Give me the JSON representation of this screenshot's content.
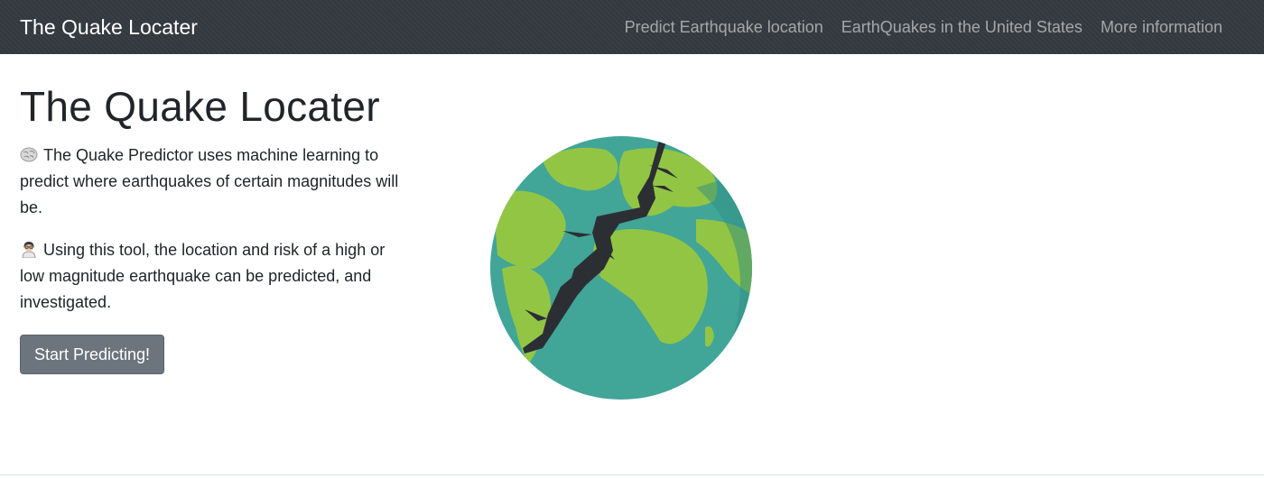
{
  "navbar": {
    "brand": "The Quake Locater",
    "links": [
      {
        "label": "Predict Earthquake location"
      },
      {
        "label": "EarthQuakes in the United States"
      },
      {
        "label": "More information"
      }
    ]
  },
  "main": {
    "title": "The Quake Locater",
    "paragraphs": [
      {
        "icon": "brain-emoji-icon",
        "text": "The Quake Predictor uses machine learning to predict where earthquakes of certain magnitudes will be."
      },
      {
        "icon": "scientist-emoji-icon",
        "text": "Using this tool, the location and risk of a high or low magnitude earthquake can be predicted, and investigated."
      }
    ],
    "cta_label": "Start Predicting!"
  },
  "illustration": {
    "name": "cracked-earth-illustration",
    "ocean_color": "#41a598",
    "land_color": "#93c544",
    "crack_color": "#2b2f33"
  },
  "colors": {
    "navbar_bg": "#343a40",
    "button_bg": "#6c757d"
  }
}
